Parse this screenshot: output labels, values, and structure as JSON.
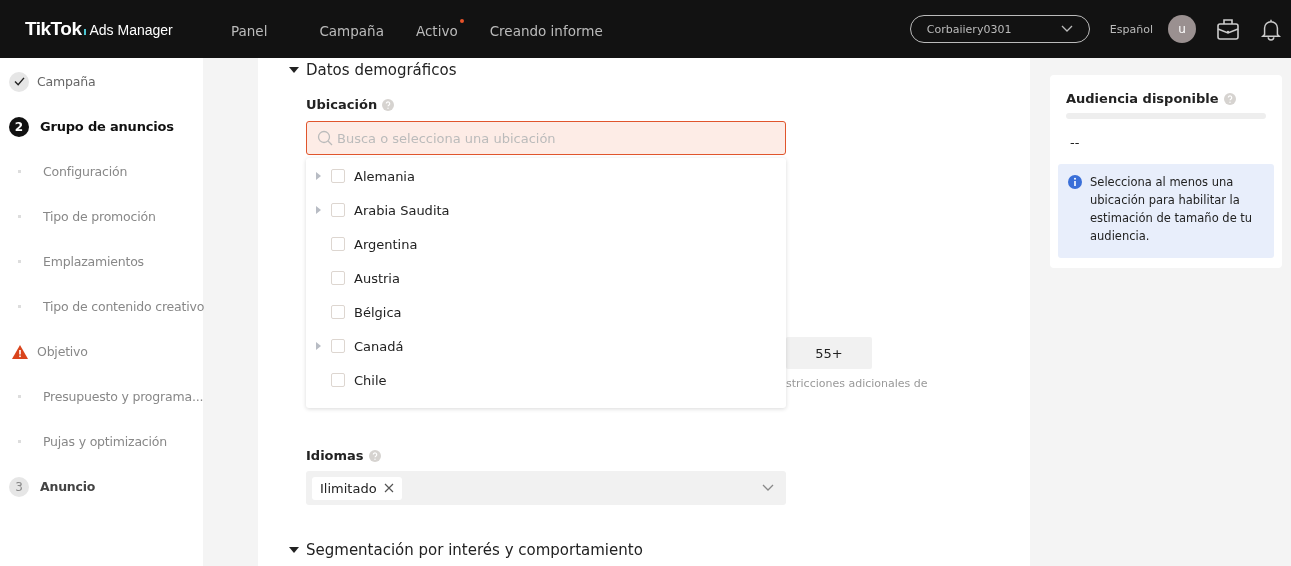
{
  "header": {
    "logo": {
      "brand": "TikTok",
      "product": "Ads Manager"
    },
    "nav": [
      {
        "label": "Panel",
        "dot": false
      },
      {
        "label": "Campaña",
        "dot": false
      },
      {
        "label": "Activo",
        "dot": true
      },
      {
        "label": "Creando informe",
        "dot": false
      }
    ],
    "account": "Corbaiiery0301",
    "language": "Español",
    "avatar": "u"
  },
  "sidebar": {
    "items": [
      {
        "label": "Campaña",
        "kind": "done"
      },
      {
        "label": "Grupo de anuncios",
        "kind": "current",
        "number": "2"
      },
      {
        "label": "Configuración",
        "kind": "sub"
      },
      {
        "label": "Tipo de promoción",
        "kind": "sub"
      },
      {
        "label": "Emplazamientos",
        "kind": "sub"
      },
      {
        "label": "Tipo de contenido creativo",
        "kind": "sub"
      },
      {
        "label": "Objetivo",
        "kind": "warning"
      },
      {
        "label": "Presupuesto y programa...",
        "kind": "sub"
      },
      {
        "label": "Pujas y optimización",
        "kind": "sub"
      },
      {
        "label": "Anuncio",
        "kind": "pending",
        "number": "3"
      }
    ]
  },
  "main": {
    "section_title": "Datos demográficos",
    "location": {
      "label": "Ubicación",
      "placeholder": "Busca o selecciona una ubicación",
      "error": true,
      "options": [
        {
          "label": "Alemania",
          "expandable": true,
          "checked": false
        },
        {
          "label": "Arabia Saudita",
          "expandable": true,
          "checked": false
        },
        {
          "label": "Argentina",
          "expandable": false,
          "checked": false
        },
        {
          "label": "Austria",
          "expandable": false,
          "checked": false
        },
        {
          "label": "Bélgica",
          "expandable": false,
          "checked": false
        },
        {
          "label": "Canadá",
          "expandable": true,
          "checked": false
        },
        {
          "label": "Chile",
          "expandable": false,
          "checked": false
        }
      ]
    },
    "age_option": "55+",
    "age_note": "stricciones adicionales de",
    "languages": {
      "label": "Idiomas",
      "tags": [
        "Ilimitado"
      ]
    },
    "next_section": "Segmentación por interés y comportamiento"
  },
  "audience": {
    "title": "Audiencia disponible",
    "value": "--",
    "info": "Selecciona al menos una ubicación para habilitar la estimación de tamaño de tu audiencia."
  }
}
